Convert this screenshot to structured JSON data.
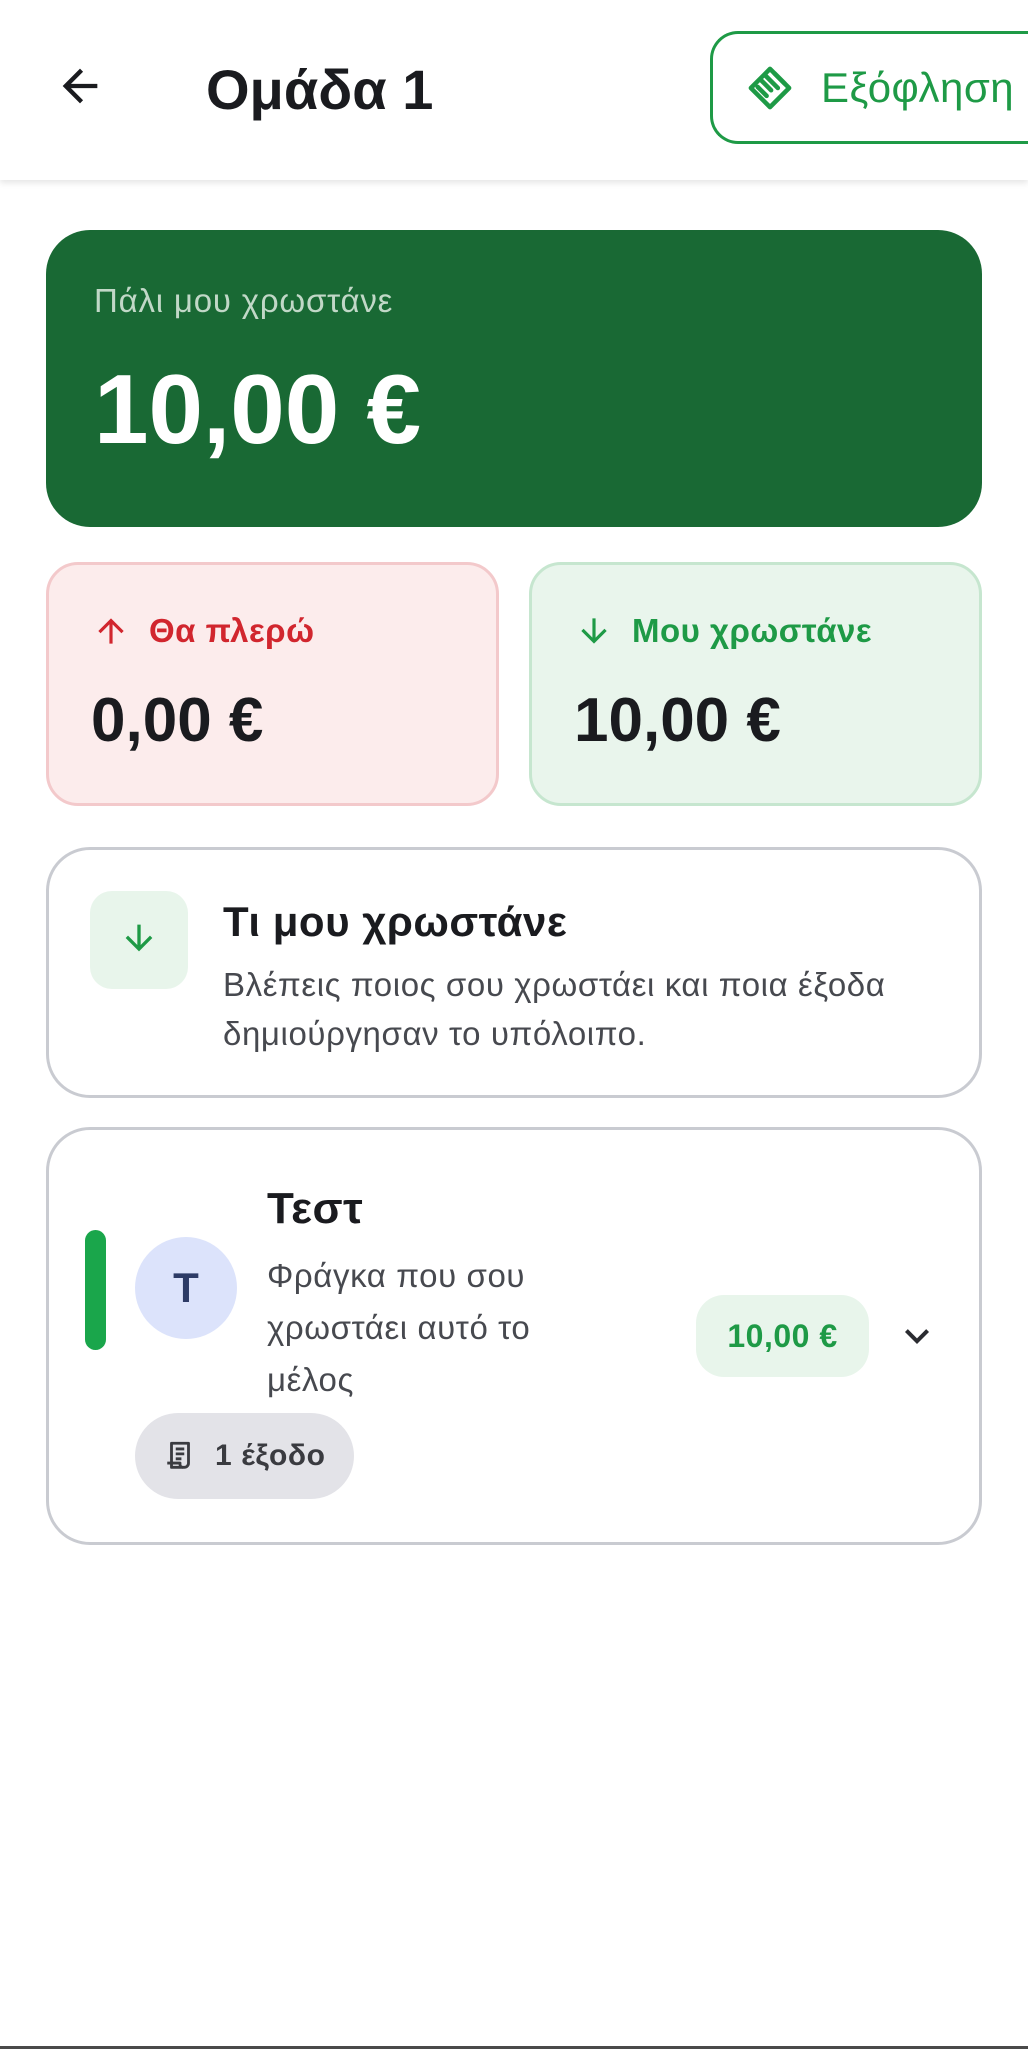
{
  "header": {
    "title": "Ομάδα 1",
    "settle_label": "Εξόφληση"
  },
  "balance": {
    "caption": "Πάλι μου χρωστάνε",
    "amount": "10,00 €"
  },
  "pay_card": {
    "label": "Θα πλερώ",
    "amount": "0,00 €"
  },
  "owed_card": {
    "label": "Μου χρωστάνε",
    "amount": "10,00 €"
  },
  "info": {
    "title": "Τι μου χρωστάνε",
    "text": "Βλέπεις ποιος σου χρωστάει και ποια έξοδα δημιούργησαν το υπόλοιπο."
  },
  "member": {
    "avatar_initial": "T",
    "name": "Τεστ",
    "description": "Φράγκα που σου χρωστάει αυτό το μέλος",
    "amount": "10,00 €",
    "expense_chip": "1 έξοδο"
  },
  "icons": {
    "back": "arrow-left-icon",
    "settle": "handshake-icon",
    "pay": "arrow-up-icon",
    "owed": "arrow-down-icon",
    "info": "arrow-down-icon",
    "expand": "chevron-down-icon",
    "expense": "receipt-icon"
  },
  "colors": {
    "primary_green": "#1e9a46",
    "balance_card": "#196934",
    "pay_red": "#d1262e",
    "pay_bg": "#fcecec",
    "owed_bg": "#e9f5ec",
    "avatar_bg": "#dce3fb",
    "member_bar": "#1aa64b"
  }
}
